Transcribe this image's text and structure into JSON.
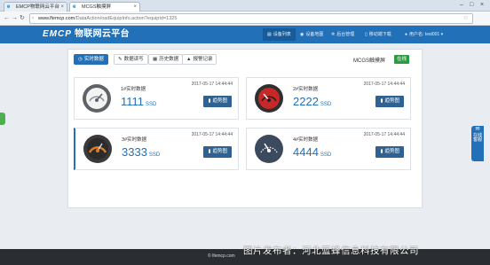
{
  "browser": {
    "tabs": [
      {
        "label": "EMCP物联网云平台",
        "favicon": "ie-icon"
      },
      {
        "label": "MCGS触摸屏",
        "favicon": "ie-icon"
      }
    ],
    "url_host": "www.lfemcp.com",
    "url_path": "/DataAction/oadEquipInfo.action?equipId=1325"
  },
  "header": {
    "logo_brand": "EMCP",
    "logo_text": "物联网云平台",
    "nav": [
      {
        "label": "设备列表",
        "icon": "list-icon"
      },
      {
        "label": "设备地图",
        "icon": "map-icon"
      },
      {
        "label": "后台管理",
        "icon": "gear-icon"
      },
      {
        "label": "移动端下载",
        "icon": "mobile-icon"
      },
      {
        "label": "用户名: test001",
        "icon": "user-icon"
      }
    ]
  },
  "subtabs": [
    {
      "label": "实时数据",
      "icon": "clock-icon"
    },
    {
      "label": "数据读写",
      "icon": "edit-icon"
    },
    {
      "label": "历史数据",
      "icon": "table-icon"
    },
    {
      "label": "报警记录",
      "icon": "bell-icon"
    }
  ],
  "device": {
    "name": "MCGS触摸屏",
    "status": "在线",
    "status_color": "#2e9a42"
  },
  "cards": [
    {
      "title": "1#实时数据",
      "time": "2017-05-17 14:44:44",
      "value": "1111",
      "unit": "SSD",
      "button": "趋势图",
      "gauge": "gauge-white-icon"
    },
    {
      "title": "2#实时数据",
      "time": "2017-05-17 14:44:44",
      "value": "2222",
      "unit": "SSD",
      "button": "趋势图",
      "gauge": "gauge-red-icon"
    },
    {
      "title": "3#实时数据",
      "time": "2017-05-17 14:44:44",
      "value": "3333",
      "unit": "SSD",
      "button": "趋势图",
      "gauge": "gauge-orange-icon"
    },
    {
      "title": "4#实时数据",
      "time": "2017-05-17 14:44:44",
      "value": "4444",
      "unit": "SSD",
      "button": "趋势图",
      "gauge": "gauge-dark-icon"
    }
  ],
  "float_service": {
    "label": "在线客服",
    "icon": "chat-icon"
  },
  "footer": {
    "text": "lfemcp.com"
  },
  "watermark": "图片发布者：河北蓝蜂信息科技有限公司",
  "colors": {
    "accent": "#2270b8",
    "online": "#2e9a42",
    "footer": "#2a2d31"
  }
}
